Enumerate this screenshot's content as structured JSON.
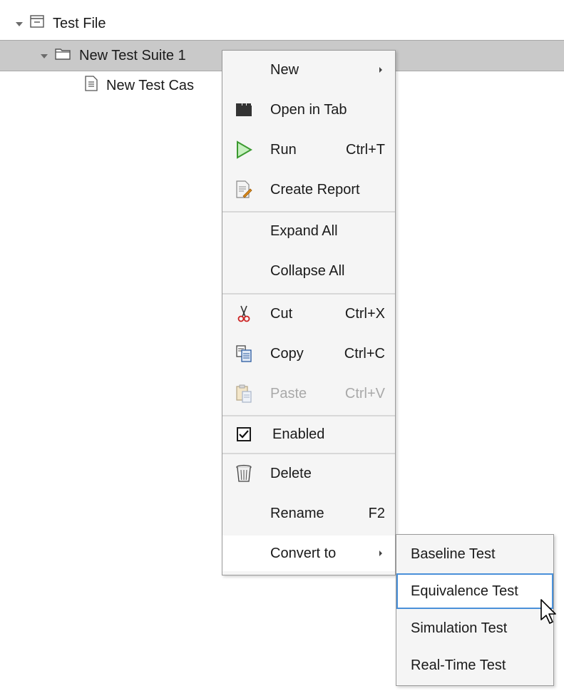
{
  "tree": {
    "file_label": "Test File",
    "suite_label": "New Test Suite 1",
    "case_label": "New Test Cas"
  },
  "menu": {
    "items": [
      {
        "label": "New",
        "shortcut": "",
        "icon": "none",
        "submenu": true
      },
      {
        "label": "Open in Tab",
        "shortcut": "",
        "icon": "tab-icon"
      },
      {
        "label": "Run",
        "shortcut": "Ctrl+T",
        "icon": "play-icon"
      },
      {
        "label": "Create Report",
        "shortcut": "",
        "icon": "report-icon"
      },
      {
        "label": "Expand All",
        "shortcut": "",
        "icon": "none"
      },
      {
        "label": "Collapse All",
        "shortcut": "",
        "icon": "none"
      },
      {
        "label": "Cut",
        "shortcut": "Ctrl+X",
        "icon": "scissors-icon"
      },
      {
        "label": "Copy",
        "shortcut": "Ctrl+C",
        "icon": "copy-icon"
      },
      {
        "label": "Paste",
        "shortcut": "Ctrl+V",
        "icon": "paste-icon",
        "disabled": true
      },
      {
        "label": "Enabled",
        "shortcut": "",
        "icon": "checkbox-checked-icon",
        "checked": true
      },
      {
        "label": "Delete",
        "shortcut": "",
        "icon": "trash-icon"
      },
      {
        "label": "Rename",
        "shortcut": "F2",
        "icon": "none"
      },
      {
        "label": "Convert to",
        "shortcut": "",
        "icon": "none",
        "submenu": true,
        "active": true
      }
    ]
  },
  "submenu": {
    "items": [
      {
        "label": "Baseline Test"
      },
      {
        "label": "Equivalence Test",
        "hover": true
      },
      {
        "label": "Simulation Test"
      },
      {
        "label": "Real-Time Test"
      }
    ]
  },
  "colors": {
    "selected_row": "#c9c9c9",
    "menu_bg": "#f5f5f5",
    "hover_outline": "#4a90d9",
    "run_green": "#4caf50",
    "cut_red": "#cc2222"
  }
}
